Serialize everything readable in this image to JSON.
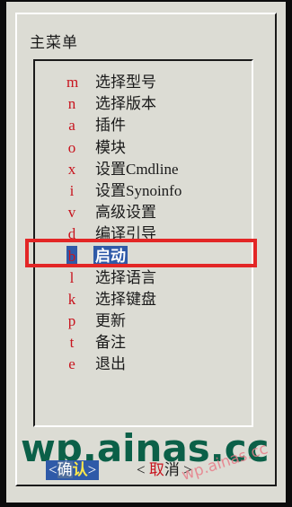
{
  "dialog": {
    "title": "主菜单"
  },
  "menu": {
    "items": [
      {
        "key": "m",
        "label": "选择型号",
        "selected": false
      },
      {
        "key": "n",
        "label": "选择版本",
        "selected": false
      },
      {
        "key": "a",
        "label": "插件",
        "selected": false
      },
      {
        "key": "o",
        "label": "模块",
        "selected": false
      },
      {
        "key": "x",
        "label": "设置Cmdline",
        "selected": false
      },
      {
        "key": "i",
        "label": "设置Synoinfo",
        "selected": false
      },
      {
        "key": "v",
        "label": "高级设置",
        "selected": false
      },
      {
        "key": "d",
        "label": "编译引导",
        "selected": false
      },
      {
        "key": "b",
        "label": "启动",
        "selected": true
      },
      {
        "key": "l",
        "label": "选择语言",
        "selected": false
      },
      {
        "key": "k",
        "label": "选择键盘",
        "selected": false
      },
      {
        "key": "p",
        "label": "更新",
        "selected": false
      },
      {
        "key": "t",
        "label": "备注",
        "selected": false
      },
      {
        "key": "e",
        "label": "退出",
        "selected": false
      }
    ]
  },
  "buttons": {
    "ok": {
      "open": "<",
      "hot": "确",
      "rest": "认",
      "close": ">"
    },
    "cancel": {
      "open": "<",
      "hot": "取",
      "rest": "消",
      "close": ">"
    }
  },
  "watermark": {
    "large": "wp.ainas.cc",
    "small": "wp.ainas.cc"
  },
  "colors": {
    "background": "#dcdcd4",
    "hotkey": "#c8141e",
    "selection": "#2f5aa8",
    "annotation_box": "#e32626",
    "watermark": "#0b6048"
  }
}
